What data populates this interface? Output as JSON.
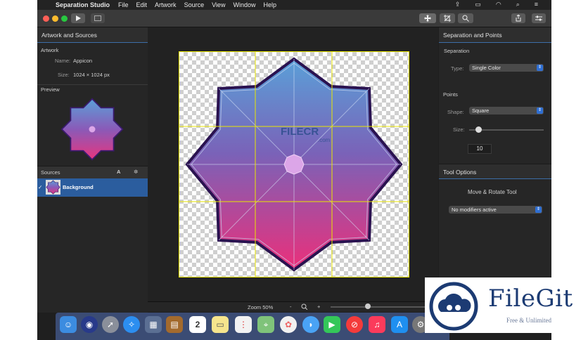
{
  "menubar": {
    "app_name": "Separation Studio",
    "items": [
      "File",
      "Edit",
      "Artwork",
      "Source",
      "View",
      "Window",
      "Help"
    ]
  },
  "left_panel": {
    "header": "Artwork and Sources",
    "artwork_section": "Artwork",
    "name_label": "Name:",
    "name_value": "Appicon",
    "size_label": "Size:",
    "size_value": "1024 × 1024 px",
    "preview_label": "Preview",
    "sources_label": "Sources",
    "sources_action": "A",
    "source_item": "Background"
  },
  "right_panel": {
    "header": "Separation and Points",
    "separation_label": "Separation",
    "type_label": "Type:",
    "type_value": "Single Color",
    "points_label": "Points",
    "shape_label": "Shape:",
    "shape_value": "Square",
    "size_label": "Size:",
    "size_value": "10",
    "size_slider_fraction": 0.12,
    "tool_options_header": "Tool Options",
    "tool_name": "Move & Rotate Tool",
    "modifiers_value": "No modifiers active"
  },
  "canvas": {
    "watermark_text": "FILECR",
    "watermark_sub": ".com"
  },
  "zoom": {
    "label": "Zoom 50%",
    "minus": "-",
    "plus": "+",
    "slider_fraction": 0.38
  },
  "dock_icons": [
    "finder-icon",
    "siri-icon",
    "launchpad-icon",
    "safari-icon",
    "photo-icon",
    "notes-book-icon",
    "calendar-icon",
    "stickies-icon",
    "reminders-icon",
    "maps-icon",
    "photos-icon",
    "messages-icon",
    "facetime-icon",
    "news-icon",
    "music-icon",
    "appstore-icon",
    "settings-icon"
  ],
  "calendar_day": "2",
  "filegit": {
    "title": "FileGit",
    "subtitle": "Free & Unlimited"
  },
  "colors": {
    "accent": "#2f6fd3",
    "guide": "#e9e600",
    "shape_top": "#5aa0d8",
    "shape_bottom": "#e8357e",
    "shape_outline": "#3a1a6e"
  }
}
